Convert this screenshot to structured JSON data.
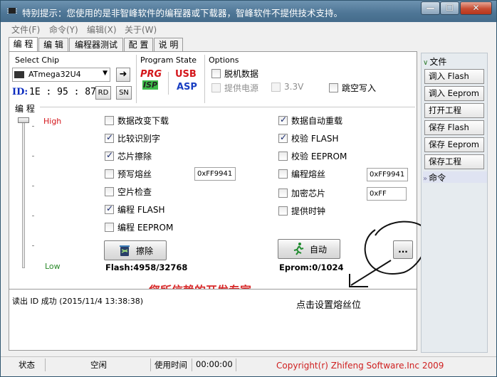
{
  "window": {
    "title": "特别提示：您使用的是非智峰软件的编程器或下载器，智峰软件不提供技术支持。",
    "minimize_glyph": "—",
    "maximize_glyph": "☐",
    "close_glyph": "✕"
  },
  "menu": [
    "文件(F)",
    "命令(Y)",
    "编辑(X)",
    "关于(W)"
  ],
  "tabs": [
    "编 程",
    "编 辑",
    "编程器测试",
    "配 置",
    "说 明"
  ],
  "select_chip": {
    "label": "Select Chip",
    "value": "ATmega32U4",
    "go_glyph": "➜",
    "id_label": "ID:",
    "id_value": "1E : 95 : 87",
    "rd": "RD",
    "sn": "SN"
  },
  "program_state": {
    "label": "Program State",
    "prg": "PRG",
    "isp": "ISP",
    "usb": "USB",
    "asp": "ASP"
  },
  "options": {
    "label": "Options",
    "offline": "脱机数据",
    "power": "提供电源",
    "voltage": "3.3V",
    "skip_empty": "跳空写入"
  },
  "program_group": {
    "label": "编 程",
    "high": "High",
    "low": "Low"
  },
  "checks_left": [
    {
      "label": "数据改变下载",
      "checked": false
    },
    {
      "label": "比较识别字",
      "checked": true
    },
    {
      "label": "芯片擦除",
      "checked": true
    },
    {
      "label": "预写熔丝",
      "checked": false
    },
    {
      "label": "空片检查",
      "checked": false
    },
    {
      "label": "编程 FLASH",
      "checked": true
    },
    {
      "label": "编程 EEPROM",
      "checked": false
    }
  ],
  "checks_right": [
    {
      "label": "数据自动重载",
      "checked": true
    },
    {
      "label": "校验 FLASH",
      "checked": true
    },
    {
      "label": "校验 EEPROM",
      "checked": false
    },
    {
      "label": "编程熔丝",
      "checked": false
    },
    {
      "label": "加密芯片",
      "checked": false
    },
    {
      "label": "提供时钟",
      "checked": false
    }
  ],
  "fuse": {
    "prewrite_value": "0xFF9941",
    "program_value": "0xFF9941",
    "lock_value": "0xFF"
  },
  "buttons": {
    "erase": "擦除",
    "auto": "自动",
    "more": "..."
  },
  "counts": {
    "flash": "Flash:4958/32768",
    "eprom": "Eprom:0/1024"
  },
  "watermark": "您所信赖的开发专家",
  "log": {
    "line": "读出 ID 成功 (2015/11/4 13:38:38)"
  },
  "annotation": "点击设置熔丝位",
  "right_panel": {
    "file_header": "文件",
    "buttons": [
      "调入 Flash",
      "调入 Eeprom",
      "打开工程",
      "保存 Flash",
      "保存 Eeprom",
      "保存工程"
    ],
    "cmd_header": "命令"
  },
  "status": {
    "state_label": "状态",
    "state_value": "空闲",
    "time_label": "使用时间",
    "time_value": "00:00:00",
    "copyright": "Copyright(r) Zhifeng Software.Inc 2009"
  },
  "colors": {
    "accent_red": "#d82a2a",
    "id_blue": "#0a2bbf",
    "title_bar": "#4d7595"
  }
}
